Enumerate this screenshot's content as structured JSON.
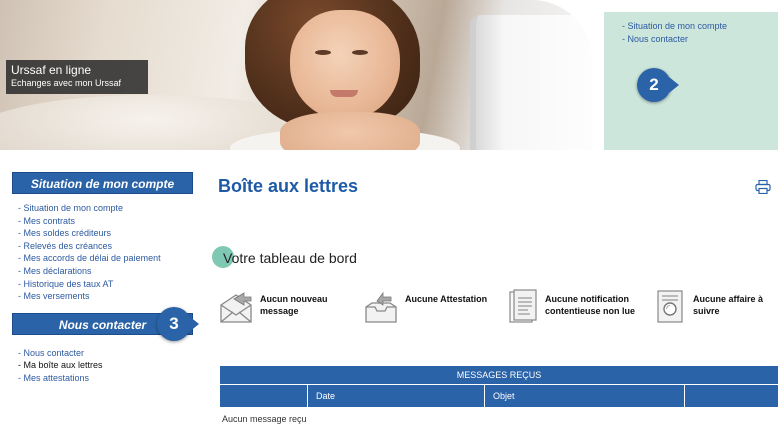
{
  "banner": {
    "title": "Urssaf en ligne",
    "subtitle": "Echanges avec mon Urssaf"
  },
  "top_links": [
    "Situation de mon compte",
    "Nous contacter"
  ],
  "callouts": {
    "two": "2",
    "three": "3"
  },
  "sidebar": {
    "section1_title": "Situation de mon compte",
    "section1_items": [
      "Situation de mon compte",
      "Mes contrats",
      "Mes soldes créditeurs",
      "Relevés des créances",
      "Mes accords de délai de paiement",
      "Mes déclarations",
      "Historique des taux AT",
      "Mes versements"
    ],
    "section2_title": "Nous contacter",
    "section2_items": [
      "Nous contacter",
      "Ma boîte aux lettres",
      "Mes attestations"
    ]
  },
  "main": {
    "title": "Boîte aux lettres",
    "dashboard_title": "Votre tableau de bord",
    "tiles": [
      {
        "label": "Aucun nouveau message",
        "icon": "envelope-icon"
      },
      {
        "label": "Aucune Attestation",
        "icon": "tray-icon"
      },
      {
        "label": "Aucune notification contentieuse non lue",
        "icon": "document-icon"
      },
      {
        "label": "Aucune affaire à suivre",
        "icon": "search-document-icon"
      }
    ],
    "table": {
      "title": "MESSAGES REÇUS",
      "columns": [
        "",
        "Date",
        "Objet",
        ""
      ],
      "empty_text": "Aucun message reçu"
    }
  },
  "colors": {
    "primary_blue": "#2a63a8",
    "title_blue": "#1f5aa6",
    "link_blue": "#2d5aa0",
    "panel_green": "#cce6dc",
    "marker_green": "#7fc8b4"
  }
}
